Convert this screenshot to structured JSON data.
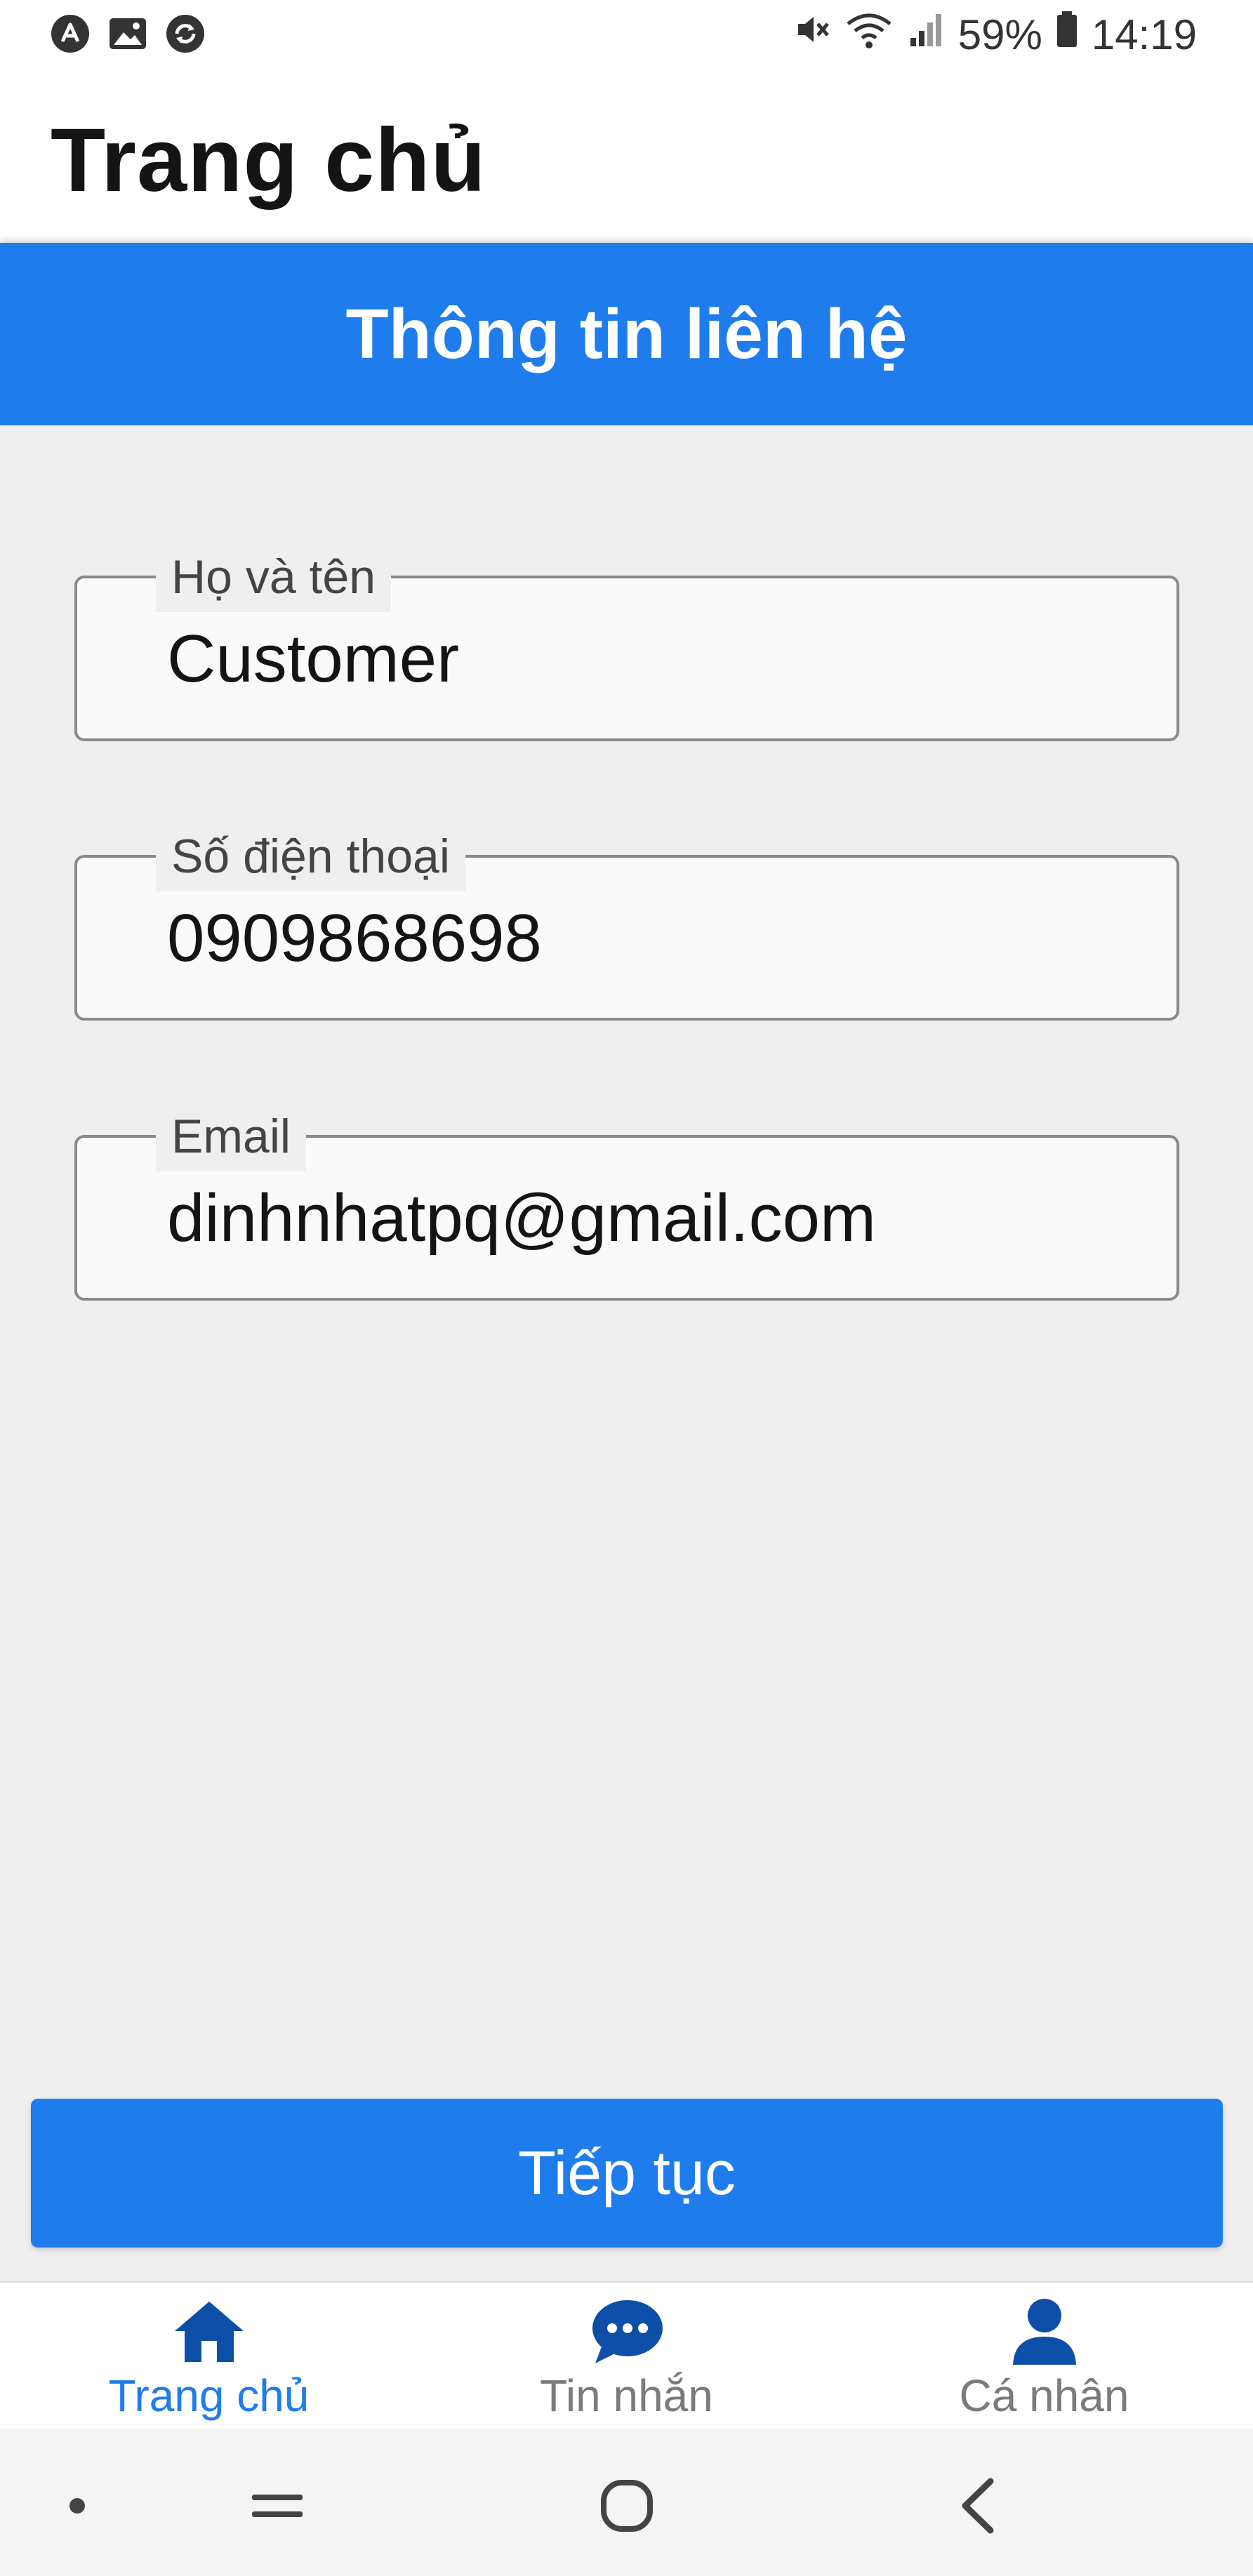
{
  "status_bar": {
    "icons_left": [
      "a-circle-icon",
      "gallery-icon",
      "sync-icon"
    ],
    "icons_right": [
      "mute-icon",
      "wifi-icon",
      "signal-icon",
      "battery-icon"
    ],
    "battery": "59%",
    "time": "14:19"
  },
  "header": {
    "title": "Trang chủ"
  },
  "section": {
    "title": "Thông tin liên hệ"
  },
  "form": {
    "fields": [
      {
        "label": "Họ và tên",
        "value": "Customer"
      },
      {
        "label": "Số điện thoại",
        "value": "0909868698"
      },
      {
        "label": "Email",
        "value": "dinhnhatpq@gmail.com"
      }
    ],
    "submit_label": "Tiếp tục"
  },
  "tabs": [
    {
      "label": "Trang chủ",
      "icon": "home-icon",
      "active": true
    },
    {
      "label": "Tin nhắn",
      "icon": "chat-icon",
      "active": false
    },
    {
      "label": "Cá nhân",
      "icon": "person-icon",
      "active": false
    }
  ],
  "colors": {
    "accent": "#1f7ced",
    "tab_active": "#1f7ced",
    "tab_inactive_icon": "#0d4fa8",
    "tab_inactive_label": "#7b7b7b"
  }
}
